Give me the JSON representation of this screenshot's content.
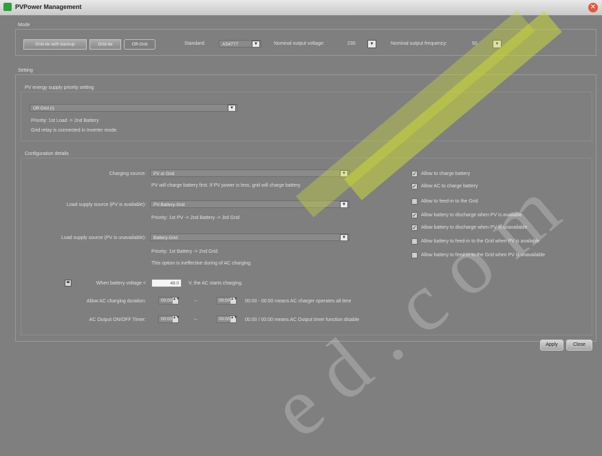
{
  "window": {
    "title": "PVPower Management",
    "close_glyph": "✕",
    "app_icon": "app-icon"
  },
  "mode": {
    "legend": "Mode",
    "btn_one": "Grid-tie with backup",
    "btn_two": "Grid-tie",
    "btn_three": "Off-Grid",
    "standard_label": "Standard:",
    "standard_value": "AS4777",
    "nominal_voltage_label": "Nominal output voltage:",
    "nominal_voltage_value": "230",
    "nominal_freq_label": "Nominal output frequency:",
    "nominal_freq_value": "50"
  },
  "setting": {
    "legend": "Setting",
    "pv_priority": {
      "legend": "PV energy supply priority setting",
      "select_value": "Off-Grid (I)",
      "line1": "Priority: 1st Load -> 2nd Battery",
      "line2": "Grid relay is connected in Inverter mode."
    },
    "config": {
      "legend": "Configuration details",
      "charging_source_label": "Charging source:",
      "charging_source_value": "PV or Grid",
      "charging_source_desc": "PV will charge battery first. If PV power is less, grid will charge battery.",
      "load_supply_pv_label": "Load supply source (PV is available):",
      "load_supply_pv_value": "PV-Battery-Grid",
      "load_supply_pv_desc": "Priority: 1st PV -> 2nd Battery -> 3rd Grid",
      "load_supply_nopv_label": "Load supply source (PV is unavailable):",
      "load_supply_nopv_value": "Battery-Grid",
      "load_supply_nopv_desc1": "Priority: 1st Battery -> 2nd Grid",
      "load_supply_nopv_desc2": "This option is ineffective during of AC charging.",
      "battery_voltage_label": "When battery voltage <",
      "battery_voltage_value": "48.0",
      "battery_voltage_unit": "V,  the AC starts charging.",
      "ac_charging_label": "Allow AC charging duration:",
      "ac_charging_start": "00:00",
      "ac_charging_sep": "--",
      "ac_charging_end": "00:00",
      "ac_charging_desc": "00:00 - 00:00 means AC charger operates all time",
      "ac_output_label": "AC Output ON/OFF Timer:",
      "ac_output_start": "00:00",
      "ac_output_sep": "--",
      "ac_output_end": "00:00",
      "ac_output_desc": "00:00 / 00:00 means AC Output timer function disable",
      "checkboxes": [
        {
          "label": "Allow to charge battery",
          "checked": "✓"
        },
        {
          "label": "Allow AC to charge battery",
          "checked": "✓"
        },
        {
          "label": "Allow to feed-in to the Grid",
          "checked": ""
        },
        {
          "label": "Allow battery to discharge when PV is available",
          "checked": "✓"
        },
        {
          "label": "Allow battery to discharge when PV is unavailable",
          "checked": "✓"
        },
        {
          "label": "Allow battery to feed-in to the Grid when PV is available",
          "checked": ""
        },
        {
          "label": "Allow battery to feed-in to the Grid when PV is unavailable",
          "checked": ""
        }
      ]
    }
  },
  "footer": {
    "apply": "Apply",
    "close": "Close"
  },
  "icons": {
    "dropdown": "▼",
    "spin": "▲▼"
  },
  "colors": {
    "background": "#7f7f7f",
    "watermark": "#c8d83a",
    "close": "#e05a3a"
  },
  "watermark_text": "ed.com"
}
